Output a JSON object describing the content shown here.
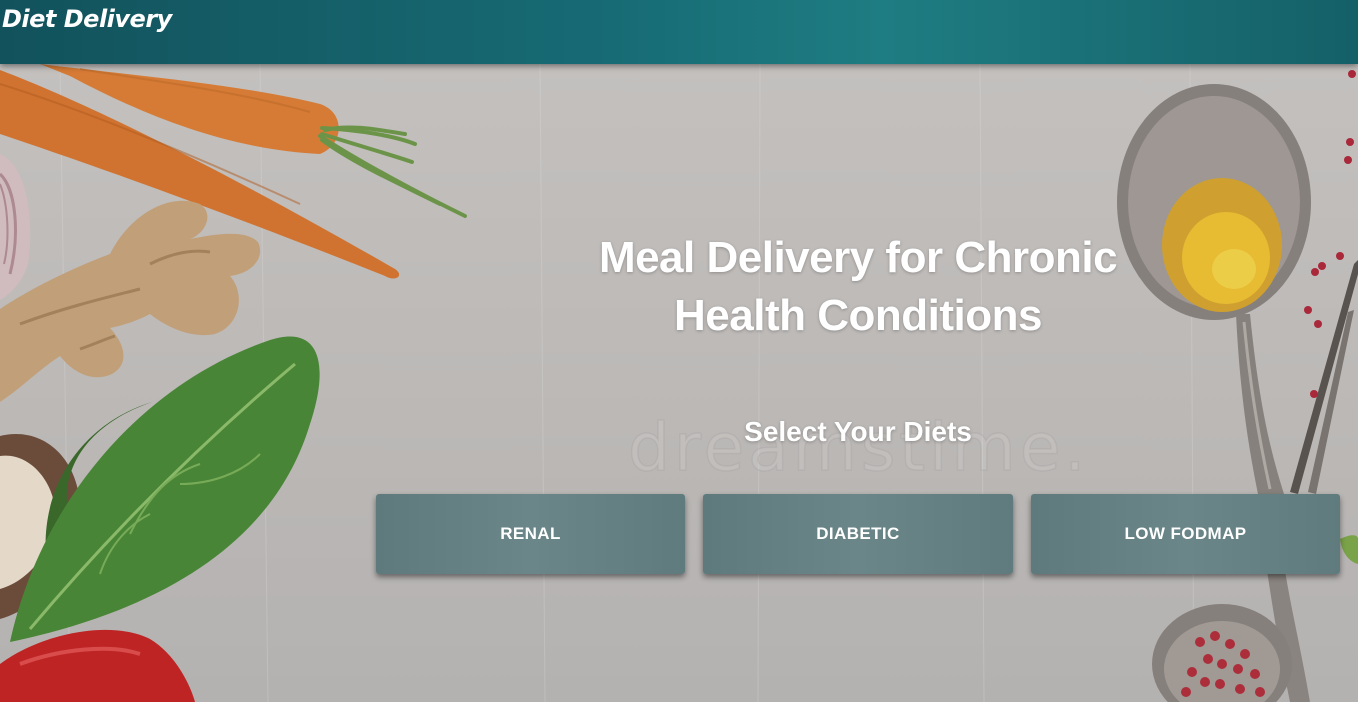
{
  "header": {
    "brand": "Diet Delivery"
  },
  "hero": {
    "title_line1": "Meal Delivery for Chronic",
    "title_line2": "Health Conditions",
    "subtitle": "Select Your Diets",
    "watermark": "dreamstime."
  },
  "diets": {
    "renal": "RENAL",
    "diabetic": "DIABETIC",
    "low_fodmap": "LOW FODMAP"
  },
  "colors": {
    "header": "#176b74",
    "button": "#657f81",
    "text": "#ffffff"
  },
  "icons": {
    "background": "food-ingredients-illustration"
  }
}
